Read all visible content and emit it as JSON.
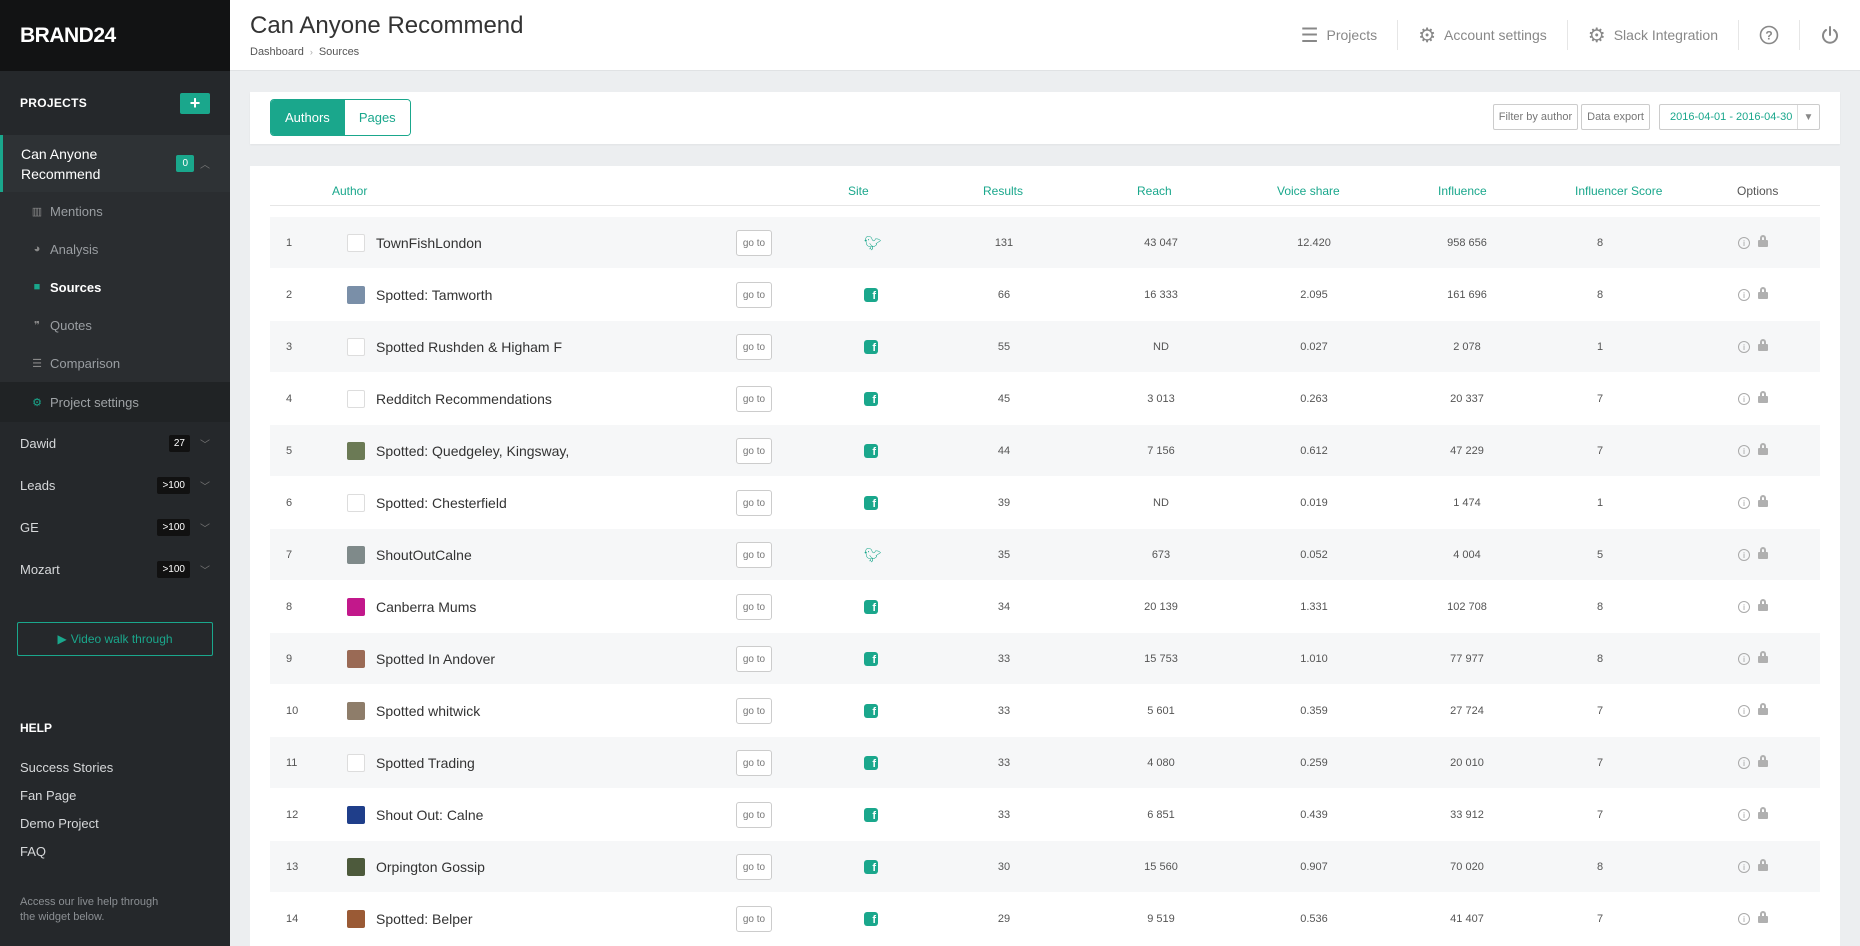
{
  "brand": "BRAND24",
  "sidebar": {
    "projects_label": "PROJECTS",
    "add_label": "+",
    "active_project": {
      "name": "Can Anyone Recommend",
      "badge": "0",
      "submenu": [
        {
          "label": "Mentions",
          "icon": "bar-chart-icon",
          "glyph": "▥"
        },
        {
          "label": "Analysis",
          "icon": "pie-chart-icon",
          "glyph": "◕"
        },
        {
          "label": "Sources",
          "icon": "briefcase-icon",
          "glyph": "■"
        },
        {
          "label": "Quotes",
          "icon": "quote-icon",
          "glyph": "❞"
        },
        {
          "label": "Comparison",
          "icon": "comparison-icon",
          "glyph": "☰"
        }
      ],
      "settings_label": "Project settings"
    },
    "other_projects": [
      {
        "name": "Dawid",
        "badge": "27"
      },
      {
        "name": "Leads",
        "badge": ">100"
      },
      {
        "name": "GE",
        "badge": ">100"
      },
      {
        "name": "Mozart",
        "badge": ">100"
      }
    ],
    "video_label": "Video walk through",
    "help_label": "HELP",
    "help_links": [
      "Success Stories",
      "Fan Page",
      "Demo Project",
      "FAQ"
    ],
    "help_note": "Access our live help through the widget below."
  },
  "header": {
    "title": "Can Anyone Recommend",
    "breadcrumbs": [
      "Dashboard",
      "Sources"
    ],
    "nav": {
      "projects": "Projects",
      "account": "Account settings",
      "slack": "Slack Integration"
    }
  },
  "toolbar": {
    "tab_authors": "Authors",
    "tab_pages": "Pages",
    "filter_label": "Filter by author",
    "export_label": "Data export",
    "date_range": "2016-04-01 - 2016-04-30"
  },
  "table": {
    "headers": {
      "author": "Author",
      "site": "Site",
      "results": "Results",
      "reach": "Reach",
      "voice_share": "Voice share",
      "influence": "Influence",
      "score": "Influencer Score",
      "options": "Options"
    },
    "goto_label": "go to",
    "rows": [
      {
        "n": "1",
        "name": "TownFishLondon",
        "site": "twitter",
        "results": "131",
        "reach": "43 047",
        "vs": "12.420",
        "inf": "958 656",
        "score": "8",
        "av": "#ffffff"
      },
      {
        "n": "2",
        "name": "Spotted: Tamworth",
        "site": "facebook",
        "results": "66",
        "reach": "16 333",
        "vs": "2.095",
        "inf": "161 696",
        "score": "8",
        "av": "#7a8fa8"
      },
      {
        "n": "3",
        "name": "Spotted Rushden & Higham F",
        "site": "facebook",
        "results": "55",
        "reach": "ND",
        "vs": "0.027",
        "inf": "2 078",
        "score": "1",
        "av": "#ffffff"
      },
      {
        "n": "4",
        "name": "Redditch Recommendations",
        "site": "facebook",
        "results": "45",
        "reach": "3 013",
        "vs": "0.263",
        "inf": "20 337",
        "score": "7",
        "av": "#ffffff"
      },
      {
        "n": "5",
        "name": "Spotted: Quedgeley, Kingsway,",
        "site": "facebook",
        "results": "44",
        "reach": "7 156",
        "vs": "0.612",
        "inf": "47 229",
        "score": "7",
        "av": "#6b7a55"
      },
      {
        "n": "6",
        "name": "Spotted: Chesterfield",
        "site": "facebook",
        "results": "39",
        "reach": "ND",
        "vs": "0.019",
        "inf": "1 474",
        "score": "1",
        "av": "#ffffff"
      },
      {
        "n": "7",
        "name": "ShoutOutCalne",
        "site": "twitter",
        "results": "35",
        "reach": "673",
        "vs": "0.052",
        "inf": "4 004",
        "score": "5",
        "av": "#7f8a8a"
      },
      {
        "n": "8",
        "name": "Canberra Mums",
        "site": "facebook",
        "results": "34",
        "reach": "20 139",
        "vs": "1.331",
        "inf": "102 708",
        "score": "8",
        "av": "#c2188b"
      },
      {
        "n": "9",
        "name": "Spotted In Andover",
        "site": "facebook",
        "results": "33",
        "reach": "15 753",
        "vs": "1.010",
        "inf": "77 977",
        "score": "8",
        "av": "#9a6a55"
      },
      {
        "n": "10",
        "name": "Spotted whitwick",
        "site": "facebook",
        "results": "33",
        "reach": "5 601",
        "vs": "0.359",
        "inf": "27 724",
        "score": "7",
        "av": "#8e7d6a"
      },
      {
        "n": "11",
        "name": "Spotted Trading",
        "site": "facebook",
        "results": "33",
        "reach": "4 080",
        "vs": "0.259",
        "inf": "20 010",
        "score": "7",
        "av": "#ffffff"
      },
      {
        "n": "12",
        "name": "Shout Out: Calne",
        "site": "facebook",
        "results": "33",
        "reach": "6 851",
        "vs": "0.439",
        "inf": "33 912",
        "score": "7",
        "av": "#1f3e8a"
      },
      {
        "n": "13",
        "name": "Orpington Gossip",
        "site": "facebook",
        "results": "30",
        "reach": "15 560",
        "vs": "0.907",
        "inf": "70 020",
        "score": "8",
        "av": "#4d5a3c"
      },
      {
        "n": "14",
        "name": "Spotted: Belper",
        "site": "facebook",
        "results": "29",
        "reach": "9 519",
        "vs": "0.536",
        "inf": "41 407",
        "score": "7",
        "av": "#9a5a35"
      }
    ]
  },
  "colors": {
    "accent": "#1aa78c",
    "sidebar": "#25282b"
  }
}
